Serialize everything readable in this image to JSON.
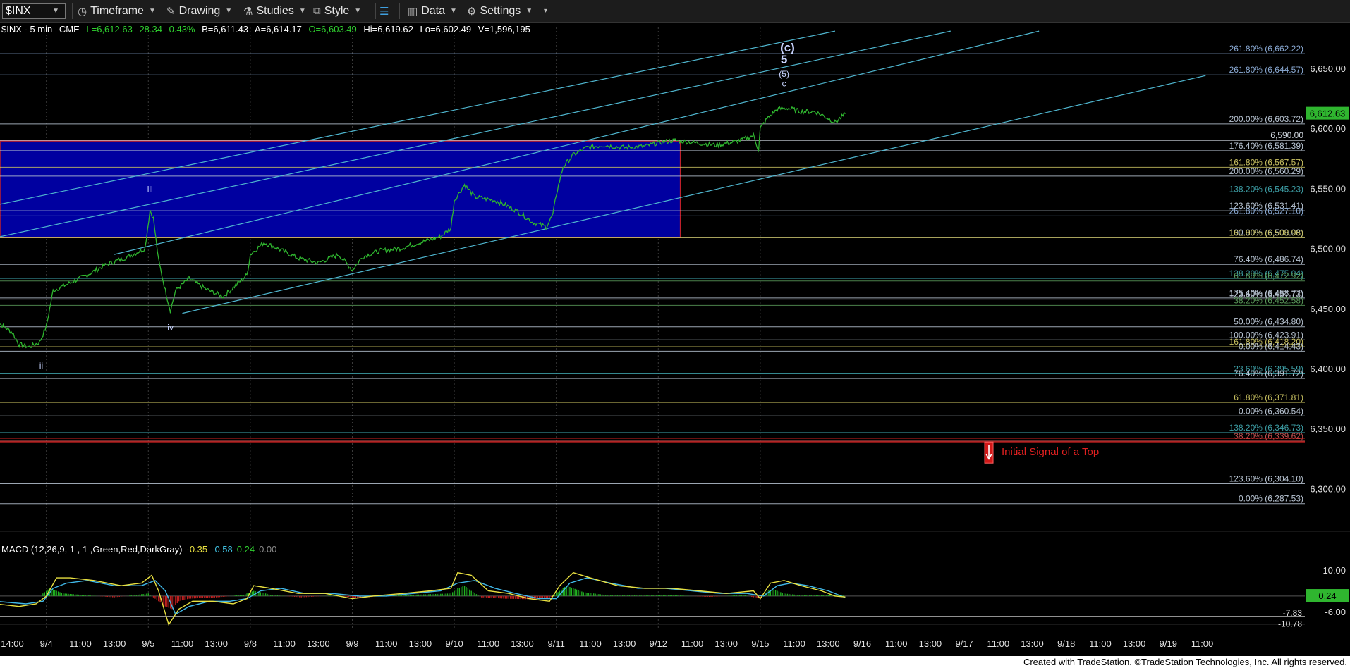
{
  "toolbar": {
    "symbol": "$INX",
    "timeframe": "Timeframe",
    "drawing": "Drawing",
    "studies": "Studies",
    "style": "Style",
    "data": "Data",
    "settings": "Settings"
  },
  "header": {
    "symbol": "$INX - 5 min",
    "exchange": "CME",
    "last": "L=6,612.63",
    "change": "28.34",
    "pct": "0.43%",
    "bid": "B=6,611.43",
    "ask": "A=6,614.17",
    "open": "O=6,603.49",
    "high": "Hi=6,619.62",
    "low": "Lo=6,602.49",
    "volume": "V=1,596,195"
  },
  "footer": {
    "text": "Created with TradeStation. ©TradeStation Technologies, Inc. All rights reserved."
  },
  "colors": {
    "price": "#2fb52f",
    "channel": "#4fb6cf",
    "zone": "#0000a0",
    "zone_border": "#c0202a",
    "signal": "#e02020"
  },
  "chart_data": {
    "type": "line",
    "price_axis": {
      "ylim": [
        6268,
        6684
      ],
      "ticks": [
        6300,
        6350,
        6400,
        6450,
        6500,
        6550,
        6600,
        6650
      ],
      "tick_labels": [
        "6,300.00",
        "6,350.00",
        "6,400.00",
        "6,450.00",
        "6,500.00",
        "6,550.00",
        "6,600.00",
        "6,650.00"
      ],
      "last_price": 6612.63,
      "last_label": "6,612.63"
    },
    "x_axis": {
      "ticks": [
        {
          "i": 0,
          "label": "14:00"
        },
        {
          "i": 1,
          "label": "9/4"
        },
        {
          "i": 2,
          "label": "11:00"
        },
        {
          "i": 3,
          "label": "13:00"
        },
        {
          "i": 4,
          "label": "9/5"
        },
        {
          "i": 5,
          "label": "11:00"
        },
        {
          "i": 6,
          "label": "13:00"
        },
        {
          "i": 7,
          "label": "9/8"
        },
        {
          "i": 8,
          "label": "11:00"
        },
        {
          "i": 9,
          "label": "13:00"
        },
        {
          "i": 10,
          "label": "9/9"
        },
        {
          "i": 11,
          "label": "11:00"
        },
        {
          "i": 12,
          "label": "13:00"
        },
        {
          "i": 13,
          "label": "9/10"
        },
        {
          "i": 14,
          "label": "11:00"
        },
        {
          "i": 15,
          "label": "13:00"
        },
        {
          "i": 16,
          "label": "9/11"
        },
        {
          "i": 17,
          "label": "11:00"
        },
        {
          "i": 18,
          "label": "13:00"
        },
        {
          "i": 19,
          "label": "9/12"
        },
        {
          "i": 20,
          "label": "11:00"
        },
        {
          "i": 21,
          "label": "13:00"
        },
        {
          "i": 22,
          "label": "9/15"
        },
        {
          "i": 23,
          "label": "11:00"
        },
        {
          "i": 24,
          "label": "13:00"
        },
        {
          "i": 25,
          "label": "9/16"
        },
        {
          "i": 26,
          "label": "11:00"
        },
        {
          "i": 27,
          "label": "13:00"
        },
        {
          "i": 28,
          "label": "9/17"
        },
        {
          "i": 29,
          "label": "11:00"
        },
        {
          "i": 30,
          "label": "13:00"
        },
        {
          "i": 31,
          "label": "9/18"
        },
        {
          "i": 32,
          "label": "11:00"
        },
        {
          "i": 33,
          "label": "13:00"
        },
        {
          "i": 34,
          "label": "9/19"
        },
        {
          "i": 35,
          "label": "11:00"
        }
      ],
      "day_separators": [
        1,
        4,
        7,
        10,
        13,
        16,
        19,
        22
      ]
    },
    "series": [
      {
        "values": [
          [
            -0.5,
            6440
          ],
          [
            0,
            6430
          ],
          [
            0.2,
            6420
          ],
          [
            0.5,
            6418
          ],
          [
            0.8,
            6422
          ],
          [
            1.0,
            6435
          ],
          [
            1.2,
            6465
          ],
          [
            1.6,
            6470
          ],
          [
            2.2,
            6478
          ],
          [
            2.8,
            6487
          ],
          [
            3.4,
            6493
          ],
          [
            3.9,
            6500
          ],
          [
            4.05,
            6532
          ],
          [
            4.15,
            6525
          ],
          [
            4.3,
            6490
          ],
          [
            4.5,
            6465
          ],
          [
            4.65,
            6448
          ],
          [
            4.8,
            6465
          ],
          [
            5.2,
            6475
          ],
          [
            5.7,
            6466
          ],
          [
            6.2,
            6460
          ],
          [
            6.6,
            6470
          ],
          [
            6.9,
            6478
          ],
          [
            7.0,
            6495
          ],
          [
            7.4,
            6505
          ],
          [
            7.8,
            6500
          ],
          [
            8.4,
            6492
          ],
          [
            9.0,
            6488
          ],
          [
            9.6,
            6495
          ],
          [
            10.0,
            6482
          ],
          [
            10.3,
            6493
          ],
          [
            10.8,
            6498
          ],
          [
            11.4,
            6500
          ],
          [
            12.0,
            6505
          ],
          [
            12.6,
            6510
          ],
          [
            12.9,
            6517
          ],
          [
            13.0,
            6540
          ],
          [
            13.3,
            6553
          ],
          [
            13.6,
            6543
          ],
          [
            14.2,
            6540
          ],
          [
            14.8,
            6532
          ],
          [
            15.3,
            6522
          ],
          [
            15.7,
            6518
          ],
          [
            15.9,
            6528
          ],
          [
            16.0,
            6545
          ],
          [
            16.2,
            6568
          ],
          [
            16.5,
            6578
          ],
          [
            16.9,
            6584
          ],
          [
            17.4,
            6586
          ],
          [
            18.0,
            6584
          ],
          [
            18.6,
            6585
          ],
          [
            19.0,
            6588
          ],
          [
            19.5,
            6590
          ],
          [
            20.1,
            6588
          ],
          [
            20.7,
            6586
          ],
          [
            21.3,
            6589
          ],
          [
            21.8,
            6594
          ],
          [
            21.9,
            6586
          ],
          [
            21.95,
            6582
          ],
          [
            22.0,
            6600
          ],
          [
            22.2,
            6608
          ],
          [
            22.5,
            6616
          ],
          [
            22.8,
            6617
          ],
          [
            23.2,
            6614
          ],
          [
            23.6,
            6614
          ],
          [
            23.9,
            6610
          ],
          [
            24.2,
            6605
          ],
          [
            24.5,
            6612
          ]
        ]
      }
    ],
    "zone": {
      "x0": -0.5,
      "x1": 19.65,
      "y_top": 6589.5,
      "y_bottom": 6509
    },
    "trend_lines": [
      {
        "i0": -0.5,
        "p0": 6536,
        "i1": 24.2,
        "p1": 6681
      },
      {
        "i0": -0.5,
        "p0": 6509,
        "i1": 27.6,
        "p1": 6681
      },
      {
        "i0": 3.0,
        "p0": 6495,
        "i1": 30.2,
        "p1": 6681
      },
      {
        "i0": 5.0,
        "p0": 6446,
        "i1": 35.1,
        "p1": 6644
      }
    ],
    "fib_levels": [
      {
        "price": 6662.22,
        "label": "261.80% (6,662.22)",
        "color": "#8aaad4"
      },
      {
        "price": 6644.57,
        "label": "261.80% (6,644.57)",
        "color": "#8aaad4"
      },
      {
        "price": 6603.72,
        "label": "200.00% (6,603.72)",
        "color": "#b8c4d2"
      },
      {
        "price": 6590.0,
        "label": "6,590.00",
        "color": "#cfd6de"
      },
      {
        "price": 6581.39,
        "label": "176.40% (6,581.39)",
        "color": "#b8c4d2"
      },
      {
        "price": 6567.57,
        "label": "161.80% (6,567.57)",
        "color": "#c8c060"
      },
      {
        "price": 6560.29,
        "label": "200.00% (6,560.29)",
        "color": "#b8c4d2"
      },
      {
        "price": 6545.23,
        "label": "138.20% (6,545.23)",
        "color": "#3ea0a8"
      },
      {
        "price": 6531.41,
        "label": "123.60% (6,531.41)",
        "color": "#b8c4d2"
      },
      {
        "price": 6527.1,
        "label": "261.80% (6,527.10)",
        "color": "#8aaad4"
      },
      {
        "price": 6509.08,
        "label": "100.00% (6,509.08)",
        "color": "#b8c4d2"
      },
      {
        "price": 6508.96,
        "label": "161.80% (6,508.96)",
        "color": "#c8c060"
      },
      {
        "price": 6486.74,
        "label": "76.40% (6,486.74)",
        "color": "#b8c4d2"
      },
      {
        "price": 6475.04,
        "label": "138.20% (6,475.04)",
        "color": "#3ea0a8"
      },
      {
        "price": 6472.92,
        "label": "61.80% (6,472.92)",
        "color": "#5a9a5a"
      },
      {
        "price": 6458.77,
        "label": "175.40% (6,458.77)",
        "color": "#b8c4d2"
      },
      {
        "price": 6457.73,
        "label": "123.60% (6,457.73)",
        "color": "#b8c4d2"
      },
      {
        "price": 6452.58,
        "label": "38.20% (6,452.58)",
        "color": "#5a9a5a"
      },
      {
        "price": 6434.8,
        "label": "50.00% (6,434.80)",
        "color": "#b8c4d2"
      },
      {
        "price": 6423.91,
        "label": "100.00% (6,423.91)",
        "color": "#b8c4d2"
      },
      {
        "price": 6418.2,
        "label": "161.80% (6,418.20)",
        "color": "#c8c060"
      },
      {
        "price": 6414.43,
        "label": "0.00% (6,414.43)",
        "color": "#b8c4d2"
      },
      {
        "price": 6395.59,
        "label": "23.60% (6,395.59)",
        "color": "#3ea0a8"
      },
      {
        "price": 6391.72,
        "label": "76.40% (6,391.72)",
        "color": "#b8c4d2"
      },
      {
        "price": 6371.81,
        "label": "61.80% (6,371.81)",
        "color": "#c8c060"
      },
      {
        "price": 6360.54,
        "label": "0.00% (6,360.54)",
        "color": "#b8c4d2"
      },
      {
        "price": 6346.73,
        "label": "138.20% (6,346.73)",
        "color": "#3ea0a8"
      },
      {
        "price": 6339.62,
        "label": "38.20% (6,339.62)",
        "color": "#c05050"
      },
      {
        "price": 6304.1,
        "label": "123.60% (6,304.10)",
        "color": "#b8c4d2"
      },
      {
        "price": 6287.53,
        "label": "0.00% (6,287.53)",
        "color": "#b8c4d2"
      }
    ],
    "red_lines": [
      6342.0,
      6339.0
    ],
    "wave_labels": [
      {
        "text": "ii",
        "i": 0.85,
        "price": 6400
      },
      {
        "text": "iii",
        "i": 4.05,
        "price": 6547
      },
      {
        "text": "iv",
        "i": 4.65,
        "price": 6432
      },
      {
        "text": "(c)",
        "i": 22.8,
        "price": 6664
      },
      {
        "text": "5",
        "i": 22.7,
        "price": 6654
      },
      {
        "text": "(5)",
        "i": 22.7,
        "price": 6643
      },
      {
        "text": "c",
        "i": 22.7,
        "price": 6635
      }
    ],
    "annotation": {
      "text": "Initial Signal of a Top",
      "i": 28.6,
      "price": 6333
    },
    "macd": {
      "title": "MACD (12,26,9, 1 , 1 ,Green,Red,DarkGray)",
      "readout": [
        "-0.35",
        "-0.58",
        "0.24",
        "0.00"
      ],
      "ylim": [
        -12.5,
        13
      ],
      "ticks": [
        10,
        -6
      ],
      "tick_labels": [
        "10.00",
        "-6.00"
      ],
      "last_label": "0.24",
      "ref_lines": [
        {
          "value": -7.83,
          "label": "-7.83"
        },
        {
          "value": -10.78,
          "label": "-10.78"
        }
      ],
      "macd_line": [
        [
          -0.5,
          -3
        ],
        [
          0.2,
          -4
        ],
        [
          0.7,
          -3
        ],
        [
          1.0,
          0
        ],
        [
          1.3,
          7
        ],
        [
          1.7,
          7
        ],
        [
          2.4,
          6
        ],
        [
          3.2,
          4
        ],
        [
          3.8,
          5
        ],
        [
          4.1,
          8
        ],
        [
          4.3,
          2
        ],
        [
          4.6,
          -11
        ],
        [
          4.9,
          -5
        ],
        [
          5.3,
          -2
        ],
        [
          5.9,
          -2
        ],
        [
          6.5,
          -3
        ],
        [
          6.9,
          -1
        ],
        [
          7.1,
          4
        ],
        [
          7.6,
          3
        ],
        [
          8.4,
          1
        ],
        [
          9.2,
          1
        ],
        [
          10.0,
          -1
        ],
        [
          10.6,
          0
        ],
        [
          11.5,
          1
        ],
        [
          12.3,
          2
        ],
        [
          12.9,
          3
        ],
        [
          13.1,
          9
        ],
        [
          13.5,
          8
        ],
        [
          14.0,
          2
        ],
        [
          14.6,
          1
        ],
        [
          15.2,
          -1
        ],
        [
          15.8,
          -2
        ],
        [
          16.1,
          4
        ],
        [
          16.5,
          9
        ],
        [
          17.0,
          7
        ],
        [
          17.8,
          4
        ],
        [
          18.6,
          3
        ],
        [
          19.4,
          3
        ],
        [
          20.2,
          2
        ],
        [
          21.0,
          1
        ],
        [
          21.8,
          2
        ],
        [
          22.0,
          -1
        ],
        [
          22.3,
          5
        ],
        [
          22.7,
          6
        ],
        [
          23.2,
          4
        ],
        [
          23.8,
          2
        ],
        [
          24.2,
          0
        ],
        [
          24.5,
          -0.35
        ]
      ],
      "signal_line": [
        [
          -0.5,
          -2
        ],
        [
          0.4,
          -3
        ],
        [
          0.9,
          -2
        ],
        [
          1.2,
          3
        ],
        [
          1.6,
          5
        ],
        [
          2.2,
          6
        ],
        [
          3.0,
          4
        ],
        [
          3.8,
          4
        ],
        [
          4.2,
          6
        ],
        [
          4.5,
          2
        ],
        [
          4.8,
          -7
        ],
        [
          5.2,
          -4
        ],
        [
          5.8,
          -2
        ],
        [
          6.4,
          -2
        ],
        [
          6.9,
          -1
        ],
        [
          7.3,
          2
        ],
        [
          7.9,
          3
        ],
        [
          8.6,
          1
        ],
        [
          9.4,
          1
        ],
        [
          10.2,
          0
        ],
        [
          11.0,
          0
        ],
        [
          11.8,
          1
        ],
        [
          12.6,
          2
        ],
        [
          13.1,
          5
        ],
        [
          13.6,
          6
        ],
        [
          14.2,
          3
        ],
        [
          14.8,
          1
        ],
        [
          15.5,
          -1
        ],
        [
          16.0,
          -1
        ],
        [
          16.4,
          5
        ],
        [
          16.9,
          7
        ],
        [
          17.6,
          5
        ],
        [
          18.4,
          3
        ],
        [
          19.2,
          3
        ],
        [
          20.0,
          2
        ],
        [
          20.8,
          1
        ],
        [
          21.6,
          1
        ],
        [
          22.1,
          0
        ],
        [
          22.5,
          4
        ],
        [
          22.9,
          5
        ],
        [
          23.4,
          4
        ],
        [
          24.0,
          2
        ],
        [
          24.5,
          -0.58
        ]
      ],
      "histogram": [
        [
          0.9,
          1
        ],
        [
          1.1,
          3
        ],
        [
          1.3,
          2
        ],
        [
          1.5,
          1
        ],
        [
          2.0,
          0.5
        ],
        [
          3.0,
          -0.5
        ],
        [
          4.0,
          1
        ],
        [
          4.3,
          -2
        ],
        [
          4.5,
          -4
        ],
        [
          4.7,
          -5
        ],
        [
          4.9,
          -2
        ],
        [
          5.2,
          -1
        ],
        [
          6.0,
          -0.5
        ],
        [
          6.8,
          0.5
        ],
        [
          7.1,
          2
        ],
        [
          7.3,
          1.5
        ],
        [
          7.6,
          0.5
        ],
        [
          8.5,
          -0.5
        ],
        [
          9.5,
          0.3
        ],
        [
          10.2,
          -0.8
        ],
        [
          11.0,
          0.3
        ],
        [
          12.0,
          0.6
        ],
        [
          12.9,
          1
        ],
        [
          13.1,
          3
        ],
        [
          13.3,
          4
        ],
        [
          13.5,
          2
        ],
        [
          13.8,
          -0.5
        ],
        [
          14.5,
          -1
        ],
        [
          15.2,
          -1.2
        ],
        [
          15.8,
          -0.8
        ],
        [
          16.1,
          2
        ],
        [
          16.3,
          4
        ],
        [
          16.5,
          3
        ],
        [
          16.8,
          1.5
        ],
        [
          17.4,
          0.5
        ],
        [
          18.5,
          0.2
        ],
        [
          19.5,
          0.3
        ],
        [
          20.5,
          -0.3
        ],
        [
          21.5,
          0.4
        ],
        [
          22.0,
          -1
        ],
        [
          22.2,
          2
        ],
        [
          22.4,
          2.5
        ],
        [
          22.7,
          1
        ],
        [
          23.2,
          0.3
        ],
        [
          24.0,
          0.4
        ],
        [
          24.5,
          0.24
        ]
      ]
    }
  }
}
